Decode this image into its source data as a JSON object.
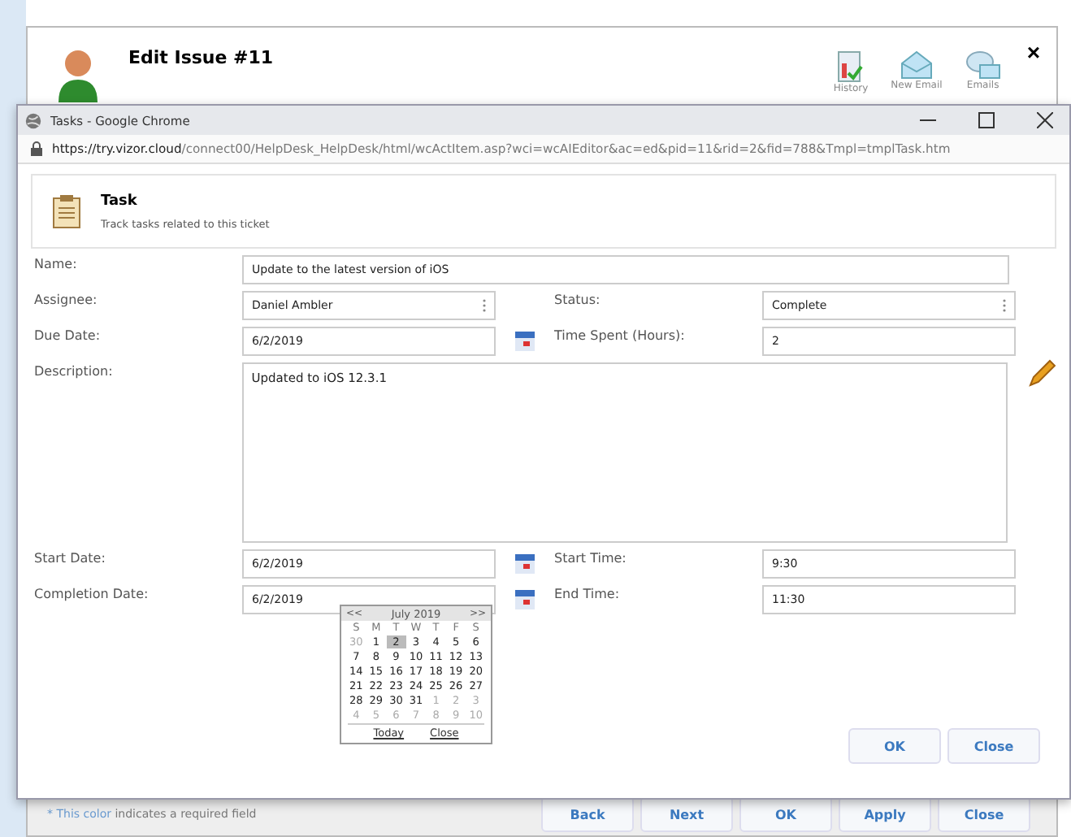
{
  "background_dialog": {
    "title": "Edit Issue #11",
    "toolbar": [
      {
        "kind": "history",
        "label": "History"
      },
      {
        "kind": "email",
        "label": "New Email"
      },
      {
        "kind": "emails",
        "label": "Emails"
      }
    ],
    "close": "×",
    "required_note": {
      "colored": "* This color",
      "rest": " indicates a required field"
    },
    "buttons": [
      "Back",
      "Next",
      "OK",
      "Apply",
      "Close"
    ]
  },
  "popup": {
    "title": "Tasks - Google Chrome",
    "url_host": "https://try.vizor.cloud",
    "url_path": "/connect00/HelpDesk_HelpDesk/html/wcActItem.asp?wci=wcAIEditor&ac=ed&pid=11&rid=2&fid=788&Tmpl=tmplTask.htm",
    "header": {
      "title": "Task",
      "subtitle": "Track tasks related to this ticket"
    },
    "fields": [
      {
        "kind": "wide",
        "label": "Name:",
        "value": "Update to the latest version of iOS"
      },
      {
        "kind": "pair",
        "label": "Assignee:",
        "value": "Daniel Ambler",
        "dropdown": true,
        "calendar": false,
        "label2": "Status:",
        "value2": "Complete",
        "dropdown2": true
      },
      {
        "kind": "pair",
        "label": "Due Date:",
        "value": "6/2/2019",
        "dropdown": false,
        "calendar": true,
        "label2": "Time Spent (Hours):",
        "value2": "2",
        "dropdown2": false
      },
      {
        "kind": "textarea",
        "label": "Description:",
        "value": "Updated to iOS 12.3.1"
      },
      {
        "kind": "pair",
        "label": "Start Date:",
        "value": "6/2/2019",
        "dropdown": false,
        "calendar": true,
        "label2": "Start Time:",
        "value2": "9:30",
        "dropdown2": false
      },
      {
        "kind": "pair",
        "label": "Completion Date:",
        "value": "6/2/2019",
        "dropdown": false,
        "calendar": true,
        "label2": "End Time:",
        "value2": "11:30",
        "dropdown2": false
      }
    ],
    "calendar": {
      "prev": "<<",
      "month": "July 2019",
      "next": ">>",
      "weekdays": [
        "S",
        "M",
        "T",
        "W",
        "T",
        "F",
        "S"
      ],
      "weeks": [
        [
          {
            "d": "30",
            "other": true,
            "selected": false
          },
          {
            "d": "1",
            "other": false,
            "selected": false
          },
          {
            "d": "2",
            "other": false,
            "selected": true
          },
          {
            "d": "3",
            "other": false,
            "selected": false
          },
          {
            "d": "4",
            "other": false,
            "selected": false
          },
          {
            "d": "5",
            "other": false,
            "selected": false
          },
          {
            "d": "6",
            "other": false,
            "selected": false
          }
        ],
        [
          {
            "d": "7",
            "other": false,
            "selected": false
          },
          {
            "d": "8",
            "other": false,
            "selected": false
          },
          {
            "d": "9",
            "other": false,
            "selected": false
          },
          {
            "d": "10",
            "other": false,
            "selected": false
          },
          {
            "d": "11",
            "other": false,
            "selected": false
          },
          {
            "d": "12",
            "other": false,
            "selected": false
          },
          {
            "d": "13",
            "other": false,
            "selected": false
          }
        ],
        [
          {
            "d": "14",
            "other": false,
            "selected": false
          },
          {
            "d": "15",
            "other": false,
            "selected": false
          },
          {
            "d": "16",
            "other": false,
            "selected": false
          },
          {
            "d": "17",
            "other": false,
            "selected": false
          },
          {
            "d": "18",
            "other": false,
            "selected": false
          },
          {
            "d": "19",
            "other": false,
            "selected": false
          },
          {
            "d": "20",
            "other": false,
            "selected": false
          }
        ],
        [
          {
            "d": "21",
            "other": false,
            "selected": false
          },
          {
            "d": "22",
            "other": false,
            "selected": false
          },
          {
            "d": "23",
            "other": false,
            "selected": false
          },
          {
            "d": "24",
            "other": false,
            "selected": false
          },
          {
            "d": "25",
            "other": false,
            "selected": false
          },
          {
            "d": "26",
            "other": false,
            "selected": false
          },
          {
            "d": "27",
            "other": false,
            "selected": false
          }
        ],
        [
          {
            "d": "28",
            "other": false,
            "selected": false
          },
          {
            "d": "29",
            "other": false,
            "selected": false
          },
          {
            "d": "30",
            "other": false,
            "selected": false
          },
          {
            "d": "31",
            "other": false,
            "selected": false
          },
          {
            "d": "1",
            "other": true,
            "selected": false
          },
          {
            "d": "2",
            "other": true,
            "selected": false
          },
          {
            "d": "3",
            "other": true,
            "selected": false
          }
        ],
        [
          {
            "d": "4",
            "other": true,
            "selected": false
          },
          {
            "d": "5",
            "other": true,
            "selected": false
          },
          {
            "d": "6",
            "other": true,
            "selected": false
          },
          {
            "d": "7",
            "other": true,
            "selected": false
          },
          {
            "d": "8",
            "other": true,
            "selected": false
          },
          {
            "d": "9",
            "other": true,
            "selected": false
          },
          {
            "d": "10",
            "other": true,
            "selected": false
          }
        ]
      ],
      "links": [
        "Today",
        "Close"
      ]
    },
    "buttons": [
      "OK",
      "Close"
    ]
  }
}
